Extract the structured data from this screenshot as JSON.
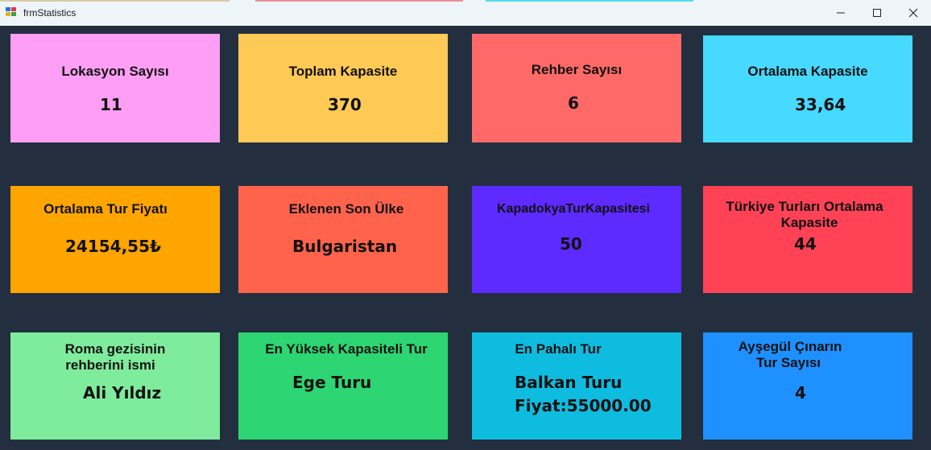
{
  "window": {
    "title": "frmStatistics",
    "icon": "winforms-app-icon",
    "controls": [
      "minimize-icon",
      "maximize-icon",
      "close-icon"
    ]
  },
  "colors": {
    "background": "#232f3f",
    "titlebar": "#eef5f9"
  },
  "cards": [
    {
      "label": "Lokasyon Sayısı",
      "value": "11",
      "color": "#ff9ef5"
    },
    {
      "label": "Toplam Kapasite",
      "value": "370",
      "color": "#fec955"
    },
    {
      "label": "Rehber Sayısı",
      "value": "6",
      "color": "#ff6a68"
    },
    {
      "label": "Ortalama Kapasite",
      "value": "33,64",
      "color": "#47d9ff"
    },
    {
      "label": "Ortalama Tur Fiyatı",
      "value": "24154,55₺",
      "color": "#ffa500"
    },
    {
      "label": "Eklenen Son Ülke",
      "value": "Bulgaristan",
      "color": "#ff634c"
    },
    {
      "label": "KapadokyaTurKapasitesi",
      "value": "50",
      "color": "#5d2aff"
    },
    {
      "label_lines": [
        "Türkiye Turları Ortalama",
        "Kapasite"
      ],
      "value": "44",
      "color": "#ff4256"
    },
    {
      "label_lines": [
        "Roma gezisinin",
        "rehberini ismi"
      ],
      "value": "Ali Yıldız",
      "color": "#7eec9c"
    },
    {
      "label": "En Yüksek Kapasiteli Tur",
      "value": "Ege Turu",
      "color": "#2ed573"
    },
    {
      "label": "En Pahalı Tur",
      "value_lines": [
        "Balkan Turu",
        "Fiyat:55000.00"
      ],
      "color": "#0ebce0"
    },
    {
      "label_lines": [
        "Ayşegül Çınarın",
        "Tur Sayısı"
      ],
      "value": "4",
      "color": "#1e90ff"
    }
  ]
}
